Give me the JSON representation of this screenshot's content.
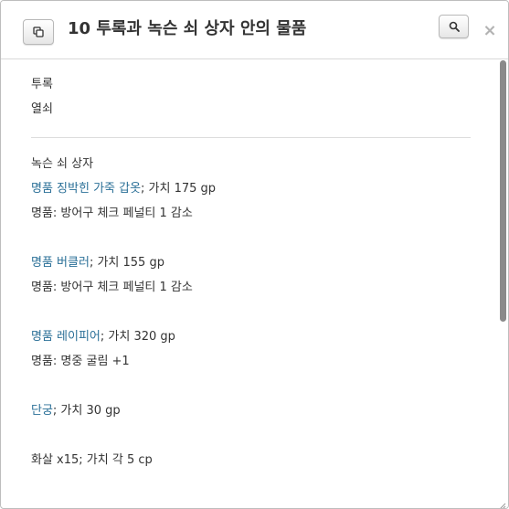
{
  "dialog": {
    "title": "10 투록과 녹슨 쇠 상자 안의 물품"
  },
  "toolbar": {
    "copy_icon": "copy-icon",
    "search_icon": "search-icon",
    "close_label": "×"
  },
  "section1": {
    "lines": [
      "투록",
      "열쇠"
    ]
  },
  "section2": {
    "heading": "녹슨 쇠 상자",
    "items": [
      {
        "link": "명품 징박힌 가죽 갑옷",
        "value": "; 가치 175 gp",
        "note": "명품: 방어구 체크 페널티 1 감소"
      },
      {
        "link": "명품 버클러",
        "value": "; 가치 155 gp",
        "note": "명품: 방어구 체크 페널티 1 감소"
      },
      {
        "link": "명품 레이피어",
        "value": "; 가치 320 gp",
        "note": "명품: 명중 굴림 +1"
      },
      {
        "link": "단궁",
        "value": "; 가치 30 gp"
      }
    ],
    "last_line": "화살 x15; 가치 각 5 cp"
  },
  "scrollbar": {
    "position_fraction": 0.55
  },
  "colors": {
    "link": "#2a6f97",
    "text": "#333333",
    "divider": "#dddddd"
  }
}
